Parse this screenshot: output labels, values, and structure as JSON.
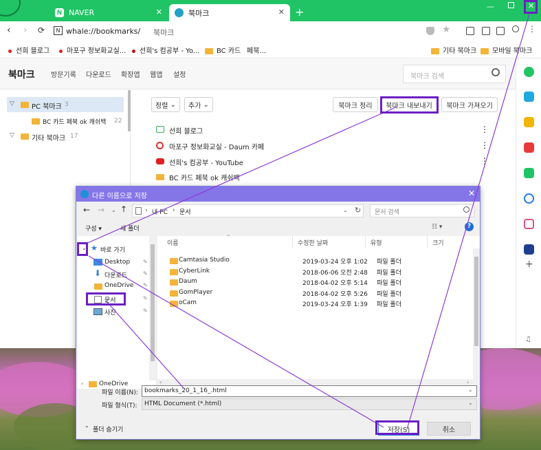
{
  "browser": {
    "tabs": [
      {
        "label": "NAVER",
        "favicon": "N",
        "active": false
      },
      {
        "label": "북마크",
        "favicon": "whale",
        "active": true
      }
    ],
    "new_tab": "+",
    "address": "whale://bookmarks/",
    "address_title": "북마크",
    "bookmarks_bar": [
      "선희 블로그",
      "마포구 정보화교실...",
      "선희's 컴공부 - Yo...",
      "BC 카드",
      "페북..."
    ],
    "bookmarks_bar_right": [
      "기타 북마크",
      "모바일 북마크"
    ]
  },
  "bookmarks_page": {
    "title": "북마크",
    "nav": [
      "방문기록",
      "다운로드",
      "확장앱",
      "웹앱",
      "설정"
    ],
    "search_placeholder": "북마크 검색",
    "tree": [
      {
        "label": "PC 북마크",
        "count": "3"
      },
      {
        "label": "BC 카드 페북 ok 캐쉬백",
        "count": "22"
      },
      {
        "label": "기타 북마크",
        "count": "17"
      }
    ],
    "sort_label": "정렬",
    "add_label": "추가",
    "actions": [
      "북마크 정리",
      "북마크 내보내기",
      "북마크 가져오기"
    ],
    "items": [
      "선희 블로그",
      "마포구 정보화교실 - Daum 카페",
      "선희's 컴공부 - YouTube",
      "BC 카드 페북 ok 캐쉬백"
    ]
  },
  "dialog": {
    "title": "다른 이름으로 저장",
    "path": [
      "내 PC",
      "문서"
    ],
    "search_placeholder": "문서 검색",
    "organize": "구성 ▾",
    "new_folder": "새 폴더",
    "help": "?",
    "quick_access": "바로 가기",
    "nav_items": [
      "Desktop",
      "다운로드",
      "OneDrive",
      "문서",
      "사진"
    ],
    "nav_bottom": "OneDrive",
    "columns": [
      "이름",
      "수정한 날짜",
      "유형",
      "크기"
    ],
    "files": [
      {
        "name": "Camtasia Studio",
        "date": "2019-03-24 오후 1:02",
        "type": "파일 폴더"
      },
      {
        "name": "CyberLink",
        "date": "2018-06-06 오전 2:48",
        "type": "파일 폴더"
      },
      {
        "name": "Daum",
        "date": "2018-04-02 오후 5:14",
        "type": "파일 폴더"
      },
      {
        "name": "GomPlayer",
        "date": "2018-04-02 오후 5:26",
        "type": "파일 폴더"
      },
      {
        "name": "oCam",
        "date": "2019-03-24 오후 1:39",
        "type": "파일 폴더"
      }
    ],
    "filename_label": "파일 이름(N):",
    "filename_value": "bookmarks_20_1_16_.html",
    "filetype_label": "파일 형식(T):",
    "filetype_value": "HTML Document (*.html)",
    "hide_folders": "폴더 숨기기",
    "save": "저장(S)",
    "cancel": "취소"
  },
  "colors": {
    "whale_green": "#20c464",
    "dialog_title": "#8576e8",
    "annotation": "#6b1fc4",
    "folder": "#f3b43a"
  }
}
